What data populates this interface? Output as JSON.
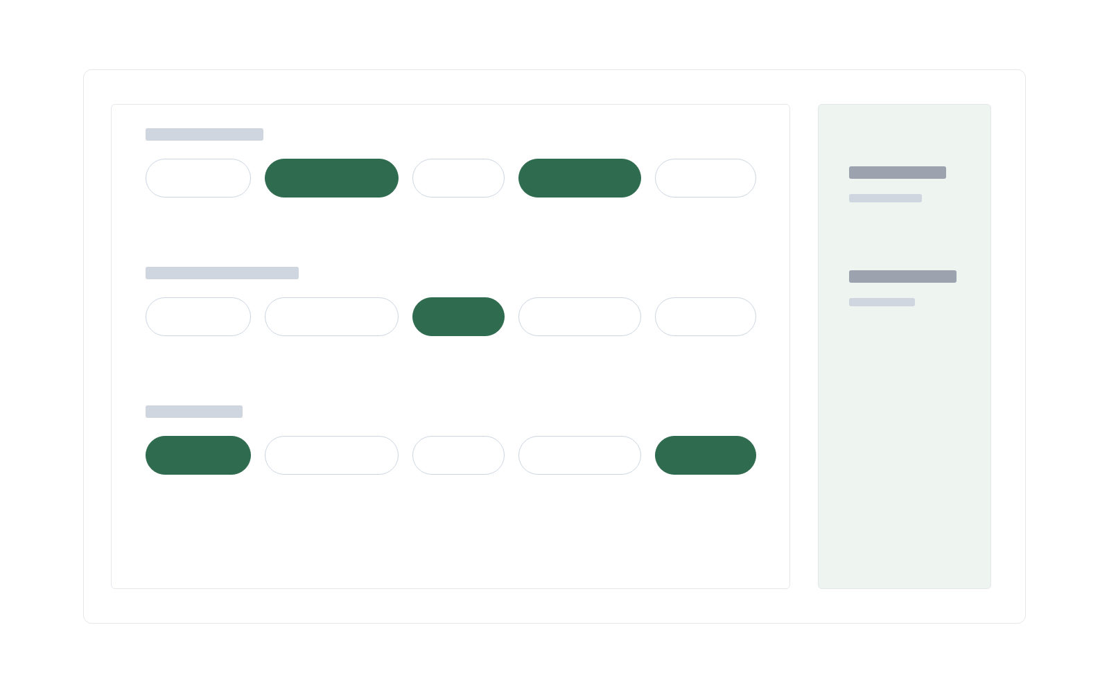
{
  "sections": [
    {
      "options": [
        {
          "selected": false
        },
        {
          "selected": true
        },
        {
          "selected": false
        },
        {
          "selected": true
        },
        {
          "selected": false
        }
      ]
    },
    {
      "options": [
        {
          "selected": false
        },
        {
          "selected": false
        },
        {
          "selected": true
        },
        {
          "selected": false
        },
        {
          "selected": false
        }
      ]
    },
    {
      "options": [
        {
          "selected": true
        },
        {
          "selected": false
        },
        {
          "selected": false
        },
        {
          "selected": false
        },
        {
          "selected": true
        }
      ]
    }
  ]
}
